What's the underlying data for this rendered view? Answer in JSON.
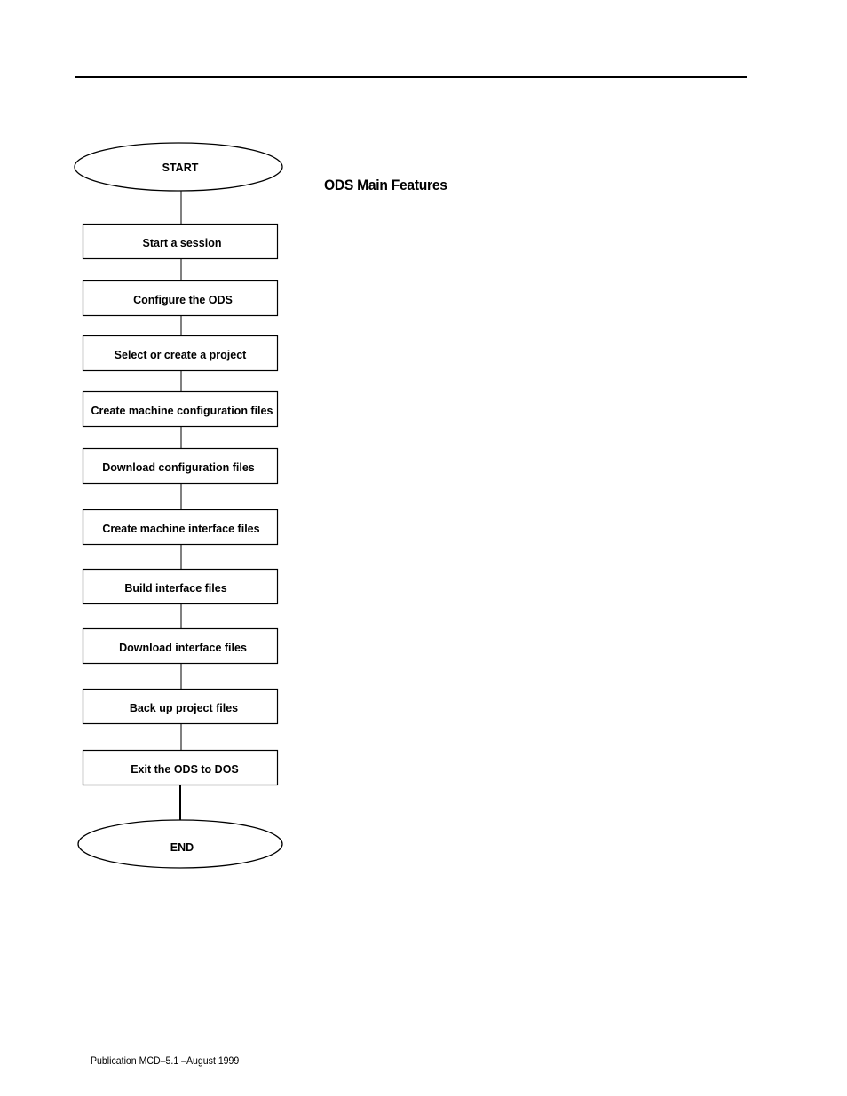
{
  "document": {
    "section_title": "ODS Main Features",
    "footer": "Publication MCD–5.1 –August 1999"
  },
  "flowchart": {
    "start": "START",
    "end": "END",
    "steps": [
      "Start a session",
      "Configure the ODS",
      "Select or create a project",
      "Create machine configuration files",
      "Download configuration files",
      "Create machine interface files",
      "Build interface files",
      "Download interface files",
      "Back up project files",
      "Exit the ODS to DOS"
    ]
  }
}
